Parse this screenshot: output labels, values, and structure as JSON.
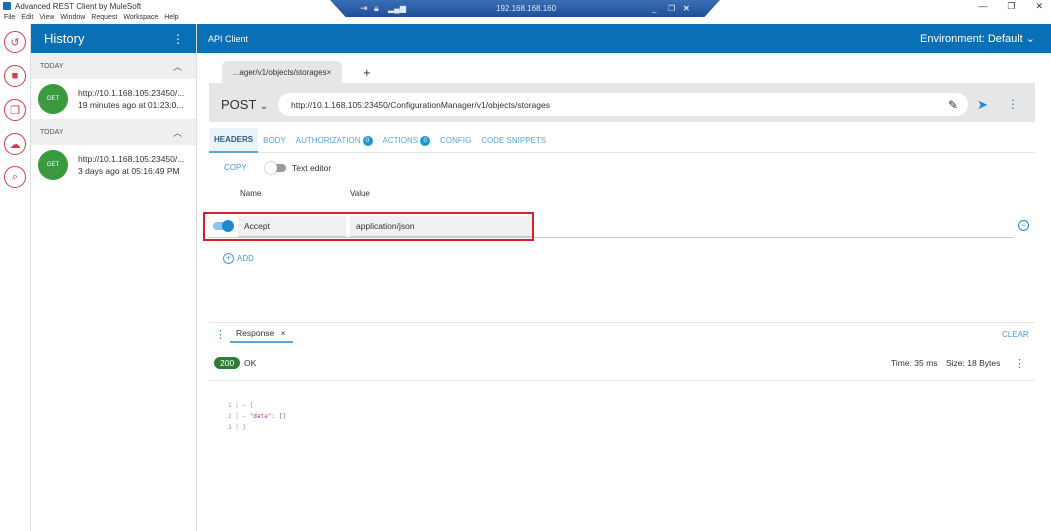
{
  "window": {
    "title": "Advanced REST Client by MuleSoft",
    "menu": [
      "File",
      "Edit",
      "View",
      "Window",
      "Request",
      "Workspace",
      "Help"
    ],
    "remote_ip": "192.168.168.160"
  },
  "history": {
    "title": "History",
    "groups": [
      {
        "label": "TODAY",
        "items": [
          {
            "method": "GET",
            "url": "http://10.1.168.105:23450/...",
            "time": "19 minutes ago at 01:23:0..."
          }
        ]
      },
      {
        "label": "TODAY",
        "items": [
          {
            "method": "GET",
            "url": "http://10.1.168.105:23450/...",
            "time": "3 days ago at 05:16:49 PM"
          }
        ]
      }
    ]
  },
  "header": {
    "title": "API Client",
    "environment": "Environment: Default"
  },
  "request": {
    "tab_label": "...ager/v1/objects/storages",
    "method": "POST",
    "url": "http://10.1.168.105:23450/ConfigurationManager/v1/objects/storages"
  },
  "tabs": [
    {
      "label": "HEADERS"
    },
    {
      "label": "BODY"
    },
    {
      "label": "AUTHORIZATION",
      "count": "0"
    },
    {
      "label": "ACTIONS",
      "count": "0"
    },
    {
      "label": "CONFIG"
    },
    {
      "label": "CODE SNIPPETS"
    }
  ],
  "headers_editor": {
    "copy": "COPY",
    "text_editor": "Text editor",
    "col_name": "Name",
    "col_value": "Value",
    "rows": [
      {
        "enabled": true,
        "name": "Accept",
        "value": "application/json"
      }
    ],
    "add": "ADD"
  },
  "response": {
    "tab": "Response",
    "clear": "CLEAR",
    "status_code": "200",
    "status_text": "OK",
    "time": "Time: 35 ms",
    "size": "Size: 18 Bytes",
    "code_lines": [
      {
        "n": "1",
        "text": "{"
      },
      {
        "n": "2",
        "text": "\"data\": []"
      },
      {
        "n": "3",
        "text": "}"
      }
    ]
  },
  "colors": {
    "primary": "#0a70b5",
    "accent": "#d33a4c",
    "highlight": "#d6202a",
    "success": "#2e7d32"
  }
}
